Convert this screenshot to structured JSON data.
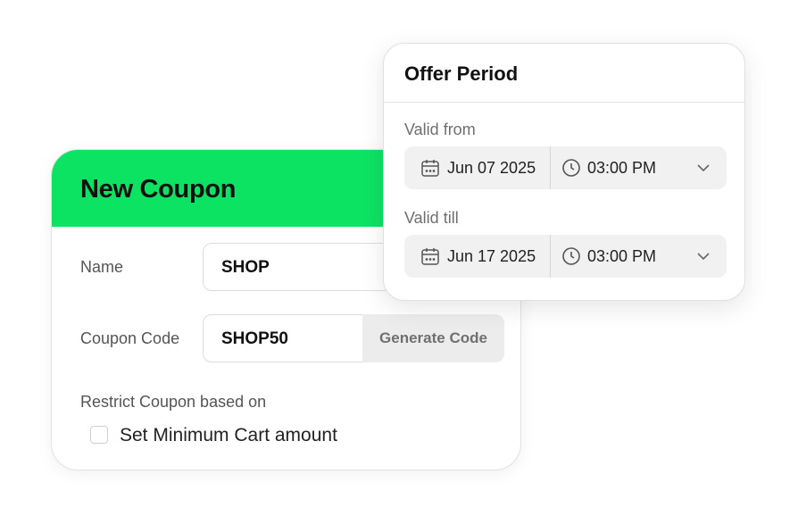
{
  "coupon": {
    "title": "New Coupon",
    "name_label": "Name",
    "name_value": "SHOP",
    "code_label": "Coupon Code",
    "code_value": "SHOP50",
    "generate_label": "Generate Code",
    "restrict_label": "Restrict Coupon based on",
    "min_cart_label": "Set Minimum Cart amount",
    "min_cart_checked": false,
    "accent_color": "#0ce363"
  },
  "offer": {
    "title": "Offer Period",
    "valid_from": {
      "label": "Valid from",
      "date": "Jun 07 2025",
      "time": "03:00 PM"
    },
    "valid_till": {
      "label": "Valid till",
      "date": "Jun 17 2025",
      "time": "03:00 PM"
    }
  },
  "icons": [
    "calendar-icon",
    "clock-icon",
    "chevron-down-icon",
    "checkbox"
  ]
}
